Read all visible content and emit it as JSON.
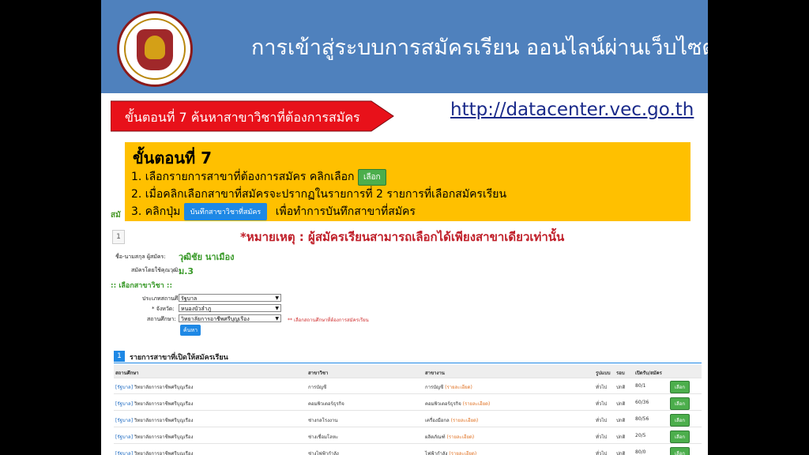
{
  "header": {
    "title": "การเข้าสู่ระบบการสมัครเรียน ออนไลน์ผ่านเว็บไซต์"
  },
  "banner": {
    "step_label": "ขั้นตอนที่ 7 ค้นหาสาขาวิชาที่ต้องการสมัคร",
    "url": "http://datacenter.vec.go.th"
  },
  "step_box": {
    "title": "ขั้นตอนที่ 7",
    "line1": "1. เลือกรายการสาขาที่ต้องการสมัคร คลิกเลือก",
    "select_button": "เลือก",
    "line2": "2. เมื่อคลิกเลือกสาขาที่สมัครจะปรากฏในรายการที่ 2 รายการที่เลือกสมัครเรียน",
    "line3_prefix": "3. คลิกปุ่ม",
    "save_button": "บันทึกสาขาวิชาที่สมัคร",
    "line3_suffix": "เพื่อทำการบันทึกสาขาที่สมัคร"
  },
  "web": {
    "left_cut": "สมั",
    "page_num": "1",
    "notice": "*หมายเหตุ : ผู้สมัครเรียนสามารถเลือกได้เพียงสาขาเดียวเท่านั้น",
    "name_label": "ชื่อ-นามสกุล ผู้สมัคร:",
    "name_value": "วุฒิชัย นาเมือง",
    "level_label": "สมัครโดยใช้คุณวุฒิ:",
    "level_value": "ม.3",
    "section_title": ":: เลือกสาขาวิชา ::",
    "inst_type_label": "ประเภทสถานศึกษา",
    "inst_type_value": "รัฐบาล",
    "province_label": "* จังหวัด:",
    "province_value": "หนองบัวลำภู",
    "school_label": "สถานศึกษา:",
    "school_value": "วิทยาลัยการอาชีพศรีบุญเรือง",
    "select_note": "** เลือกสถานศึกษาที่ต้องการสมัครเรียน",
    "search_button": "ค้นหา",
    "list_num": "1",
    "list_title": "รายการสาขาที่เปิดให้สมัครเรียน"
  },
  "table": {
    "headers": {
      "inst": "สถานศึกษา",
      "type": "สาขาวิชา",
      "branch": "สาขางาน",
      "mode": "รูปแบบ",
      "round": "รอบ",
      "seats": "เปิดรับ/สมัคร"
    },
    "rows": [
      {
        "tag": "[รัฐบาล]",
        "inst": "วิทยาลัยการอาชีพศรีบุญเรือง",
        "type": "การบัญชี",
        "branch": "การบัญชี",
        "detail": "(รายละเอียด)",
        "mode": "ทั่วไป",
        "round": "ปกติ",
        "seats": "80/1",
        "action": "เลือก"
      },
      {
        "tag": "[รัฐบาล]",
        "inst": "วิทยาลัยการอาชีพศรีบุญเรือง",
        "type": "คอมพิวเตอร์ธุรกิจ",
        "branch": "คอมพิวเตอร์ธุรกิจ",
        "detail": "(รายละเอียด)",
        "mode": "ทั่วไป",
        "round": "ปกติ",
        "seats": "60/36",
        "action": "เลือก"
      },
      {
        "tag": "[รัฐบาล]",
        "inst": "วิทยาลัยการอาชีพศรีบุญเรือง",
        "type": "ช่างกลโรงงาน",
        "branch": "เครื่องมือกล",
        "detail": "(รายละเอียด)",
        "mode": "ทั่วไป",
        "round": "ปกติ",
        "seats": "80/56",
        "action": "เลือก"
      },
      {
        "tag": "[รัฐบาล]",
        "inst": "วิทยาลัยการอาชีพศรีบุญเรือง",
        "type": "ช่างเชื่อมโลหะ",
        "branch": "ผลิตภัณฑ์",
        "detail": "(รายละเอียด)",
        "mode": "ทั่วไป",
        "round": "ปกติ",
        "seats": "20/5",
        "action": "เลือก"
      },
      {
        "tag": "[รัฐบาล]",
        "inst": "วิทยาลัยการอาชีพศรีบุญเรือง",
        "type": "ช่างไฟฟ้ากำลัง",
        "branch": "ไฟฟ้ากำลัง",
        "detail": "(รายละเอียด)",
        "mode": "ทั่วไป",
        "round": "ปกติ",
        "seats": "80/0",
        "action": "เลือก"
      }
    ]
  }
}
